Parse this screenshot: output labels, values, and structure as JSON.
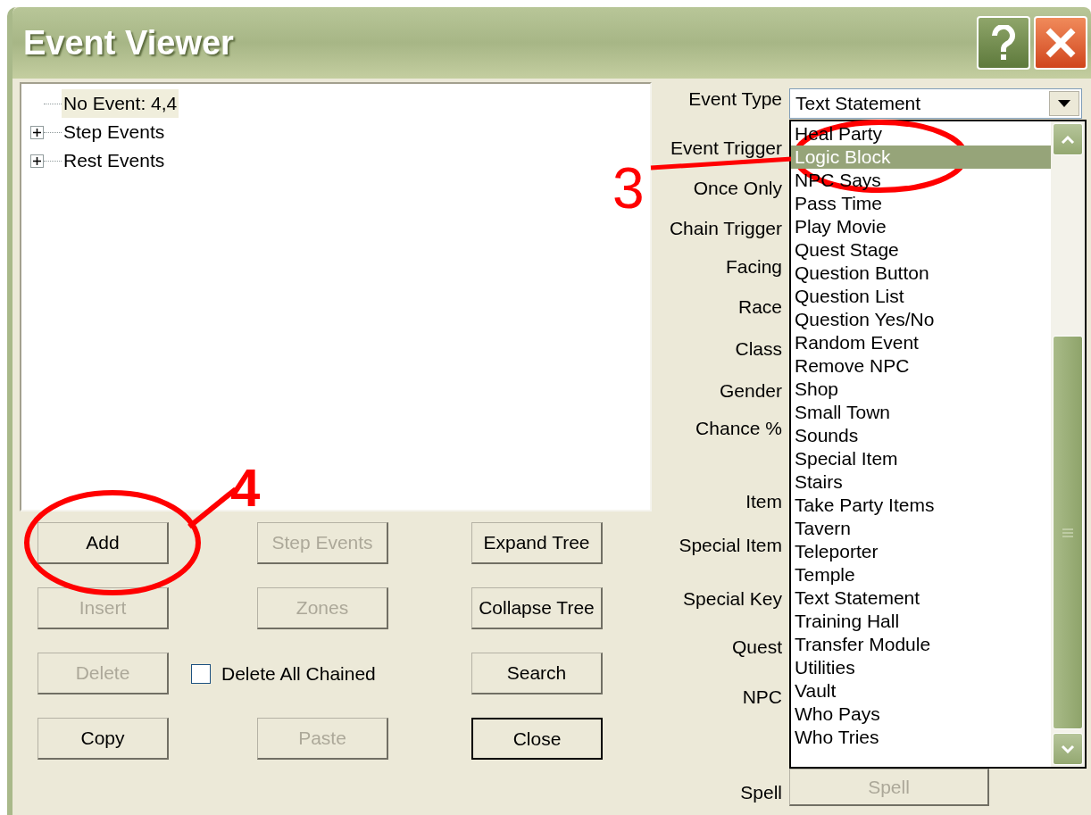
{
  "window": {
    "title": "Event Viewer"
  },
  "tree": [
    {
      "kind": "leaf",
      "label": "No Event: 4,4",
      "selected": true
    },
    {
      "kind": "folder",
      "label": "Step Events",
      "selected": false
    },
    {
      "kind": "folder",
      "label": "Rest Events",
      "selected": false
    }
  ],
  "button_rows": [
    [
      {
        "kind": "button",
        "label": "Add",
        "disabled": false,
        "default": false
      },
      {
        "kind": "button",
        "label": "Step Events",
        "disabled": true,
        "default": false
      },
      {
        "kind": "button",
        "label": "Expand Tree",
        "disabled": false,
        "default": false
      }
    ],
    [
      {
        "kind": "button",
        "label": "Insert",
        "disabled": true,
        "default": false
      },
      {
        "kind": "button",
        "label": "Zones",
        "disabled": true,
        "default": false
      },
      {
        "kind": "button",
        "label": "Collapse Tree",
        "disabled": false,
        "default": false
      }
    ],
    [
      {
        "kind": "button",
        "label": "Delete",
        "disabled": true,
        "default": false
      },
      {
        "kind": "checkbox",
        "label": "Delete All Chained",
        "checked": false
      },
      {
        "kind": "button",
        "label": "Search",
        "disabled": false,
        "default": false
      }
    ],
    [
      {
        "kind": "button",
        "label": "Copy",
        "disabled": false,
        "default": false
      },
      {
        "kind": "button",
        "label": "Paste",
        "disabled": true,
        "default": false
      },
      {
        "kind": "button",
        "label": "Close",
        "disabled": false,
        "default": true
      }
    ]
  ],
  "fields": [
    {
      "kind": "combo",
      "label": "Event Type",
      "value": "Text Statement"
    },
    {
      "kind": "label",
      "label": "Event Trigger"
    },
    {
      "kind": "label",
      "label": "Once Only"
    },
    {
      "kind": "label",
      "label": "Chain Trigger"
    },
    {
      "kind": "label",
      "label": "Facing"
    },
    {
      "kind": "label",
      "label": "Race"
    },
    {
      "kind": "label",
      "label": "Class"
    },
    {
      "kind": "label",
      "label": "Gender"
    },
    {
      "kind": "label",
      "label": "Chance %"
    },
    {
      "kind": "label",
      "label": "Item"
    },
    {
      "kind": "label",
      "label": "Special Item"
    },
    {
      "kind": "label",
      "label": "Special Key"
    },
    {
      "kind": "label",
      "label": "Quest"
    },
    {
      "kind": "label",
      "label": "NPC"
    },
    {
      "kind": "button",
      "label": "Spell",
      "button": "Spell",
      "disabled": true
    }
  ],
  "dropdown": {
    "options": [
      {
        "label": "Heal Party",
        "selected": false
      },
      {
        "label": "Logic Block",
        "selected": true
      },
      {
        "label": "NPC Says",
        "selected": false
      },
      {
        "label": "Pass Time",
        "selected": false
      },
      {
        "label": "Play Movie",
        "selected": false
      },
      {
        "label": "Quest Stage",
        "selected": false
      },
      {
        "label": "Question Button",
        "selected": false
      },
      {
        "label": "Question List",
        "selected": false
      },
      {
        "label": "Question Yes/No",
        "selected": false
      },
      {
        "label": "Random Event",
        "selected": false
      },
      {
        "label": "Remove NPC",
        "selected": false
      },
      {
        "label": "Shop",
        "selected": false
      },
      {
        "label": "Small Town",
        "selected": false
      },
      {
        "label": "Sounds",
        "selected": false
      },
      {
        "label": "Special Item",
        "selected": false
      },
      {
        "label": "Stairs",
        "selected": false
      },
      {
        "label": "Take Party Items",
        "selected": false
      },
      {
        "label": "Tavern",
        "selected": false
      },
      {
        "label": "Teleporter",
        "selected": false
      },
      {
        "label": "Temple",
        "selected": false
      },
      {
        "label": "Text Statement",
        "selected": false
      },
      {
        "label": "Training Hall",
        "selected": false
      },
      {
        "label": "Transfer Module",
        "selected": false
      },
      {
        "label": "Utilities",
        "selected": false
      },
      {
        "label": "Vault",
        "selected": false
      },
      {
        "label": "Who Pays",
        "selected": false
      },
      {
        "label": "Who Tries",
        "selected": false
      }
    ]
  },
  "annotations": [
    {
      "label": "3"
    },
    {
      "label": "4"
    }
  ]
}
